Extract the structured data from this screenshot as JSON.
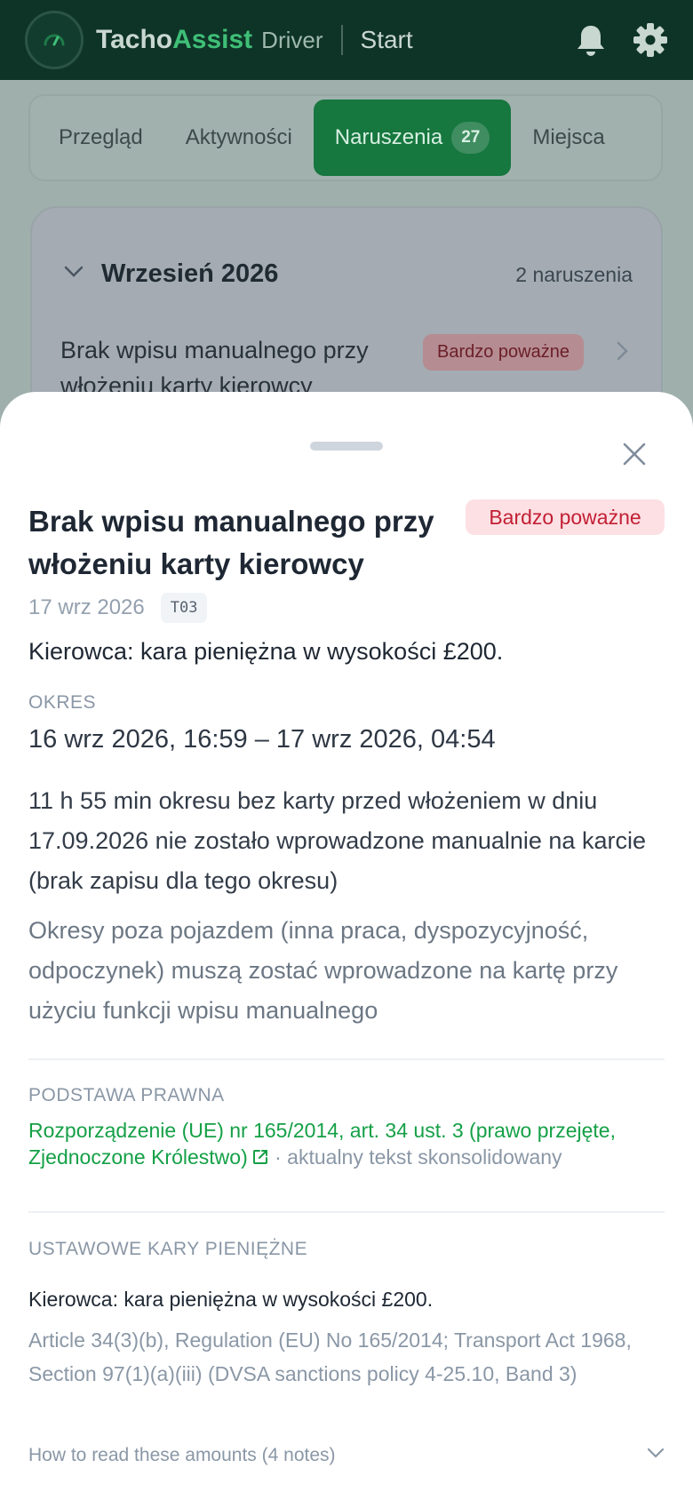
{
  "header": {
    "brand_part1": "Tacho",
    "brand_part2": "Assist",
    "brand_sub": "Driver",
    "page": "Start"
  },
  "tabs": [
    {
      "label": "Przegląd"
    },
    {
      "label": "Aktywności"
    },
    {
      "label": "Naruszenia",
      "badge": "27",
      "active": true
    },
    {
      "label": "Miejsca"
    }
  ],
  "month": {
    "title": "Wrzesień 2026",
    "count": "2 naruszenia",
    "item_title": "Brak wpisu manualnego przy włożeniu karty kierowcy",
    "item_badge": "Bardzo poważne"
  },
  "sheet": {
    "title": "Brak wpisu manualnego przy włożeniu karty kierowcy",
    "severity": "Bardzo poważne",
    "date": "17 wrz 2026",
    "code": "T03",
    "penalty": "Kierowca: kara pieniężna w wysokości £200.",
    "period_label": "OKRES",
    "period": "16 wrz 2026, 16:59 – 17 wrz 2026, 04:54",
    "description": "11 h 55 min okresu bez karty przed włożeniem w dniu 17.09.2026 nie zostało wprowadzone manualnie na karcie (brak zapisu dla tego okresu)",
    "hint": "Okresy poza pojazdem (inna praca, dyspozycyjność, odpoczynek) muszą zostać wprowadzone na kartę przy użyciu funkcji wpisu manualnego",
    "legal_label": "PODSTAWA PRAWNA",
    "legal_link": "Rozporządzenie (UE) nr 165/2014, art. 34 ust. 3 (prawo przejęte, Zjednoczone Królestwo)",
    "legal_suffix": " · aktualny tekst skonsolidowany",
    "fines_label": "USTAWOWE KARY PIENIĘŻNE",
    "fine_main": "Kierowca: kara pieniężna w wysokości £200.",
    "fine_ref": "Article 34(3)(b), Regulation (EU) No 165/2014; Transport Act 1968, Section 97(1)(a)(iii) (DVSA sanctions policy 4-25.10, Band 3)",
    "howto": "How to read these amounts (4 notes)"
  },
  "colors": {
    "header_bg": "#0e3427",
    "brand_accent": "#3fbf77",
    "active_tab": "#16773f",
    "severity_text": "#c21f34",
    "severity_bg": "#fde0e3",
    "link": "#15a047"
  },
  "icons": [
    "gauge-icon",
    "bell-icon",
    "gear-icon",
    "chevron-down-icon",
    "chevron-right-icon",
    "close-icon",
    "external-link-icon"
  ]
}
